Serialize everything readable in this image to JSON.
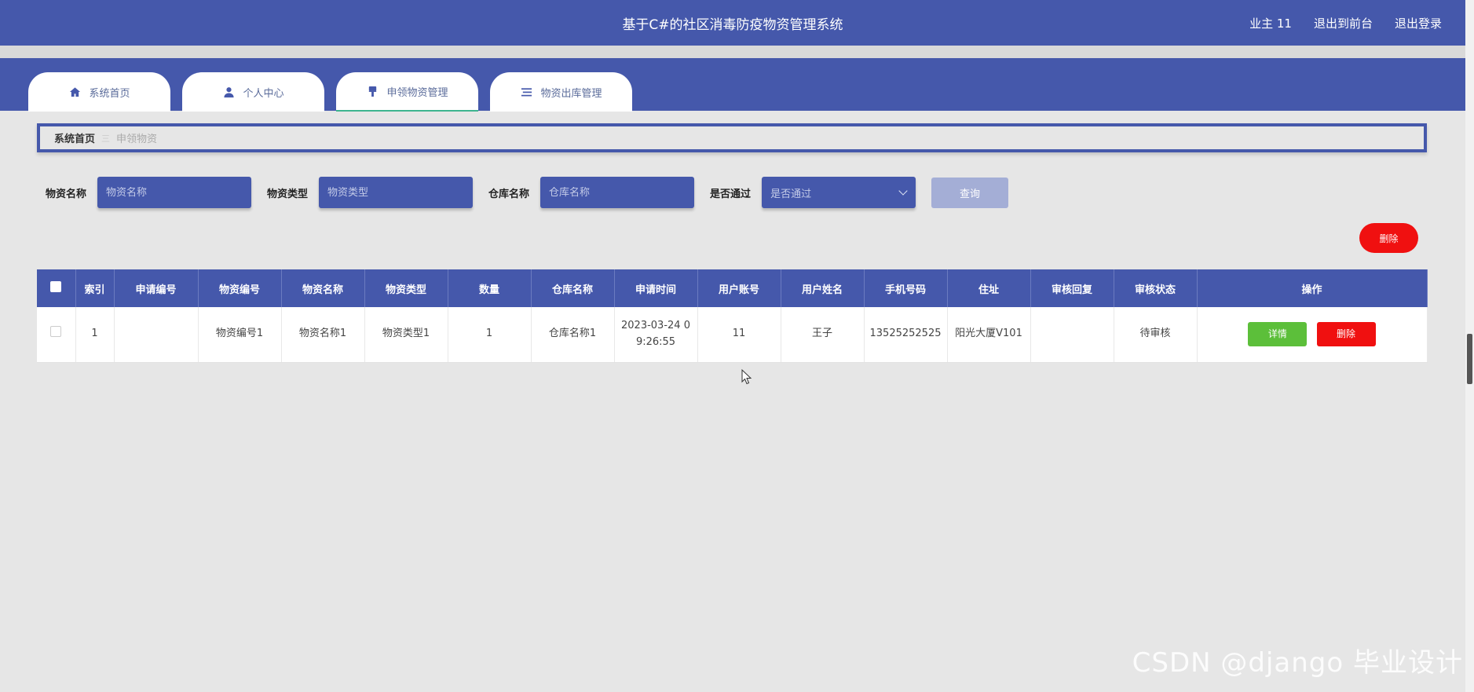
{
  "header": {
    "title": "基于C#的社区消毒防疫物资管理系统",
    "user": "业主 11",
    "to_front": "退出到前台",
    "logout": "退出登录"
  },
  "tabs": [
    {
      "label": "系统首页",
      "icon": "home-icon"
    },
    {
      "label": "个人中心",
      "icon": "user-icon"
    },
    {
      "label": "申领物资管理",
      "icon": "brush-icon"
    },
    {
      "label": "物资出库管理",
      "icon": "list-icon"
    }
  ],
  "breadcrumb": {
    "home": "系统首页",
    "separator": "三",
    "current": "申领物资"
  },
  "filters": {
    "name_label": "物资名称",
    "name_placeholder": "物资名称",
    "type_label": "物资类型",
    "type_placeholder": "物资类型",
    "warehouse_label": "仓库名称",
    "warehouse_placeholder": "仓库名称",
    "pass_label": "是否通过",
    "pass_value": "是否通过",
    "query": "查询"
  },
  "delete_top": "删除",
  "table": {
    "headers": [
      "索引",
      "申请编号",
      "物资编号",
      "物资名称",
      "物资类型",
      "数量",
      "仓库名称",
      "申请时间",
      "用户账号",
      "用户姓名",
      "手机号码",
      "住址",
      "审核回复",
      "审核状态",
      "操作"
    ],
    "rows": [
      {
        "index": "1",
        "apply_no": "",
        "item_no": "物资编号1",
        "item_name": "物资名称1",
        "item_type": "物资类型1",
        "qty": "1",
        "warehouse": "仓库名称1",
        "time": "2023-03-24 09:26:55",
        "account": "11",
        "name": "王子",
        "phone": "13525252525",
        "address": "阳光大厦V101",
        "reply": "",
        "status": "待审核",
        "detail": "详情",
        "delete": "删除"
      }
    ]
  },
  "watermark": "CSDN @django 毕业设计",
  "colors": {
    "primary": "#4558ab",
    "danger": "#f01010",
    "success": "#5cbf3a"
  }
}
